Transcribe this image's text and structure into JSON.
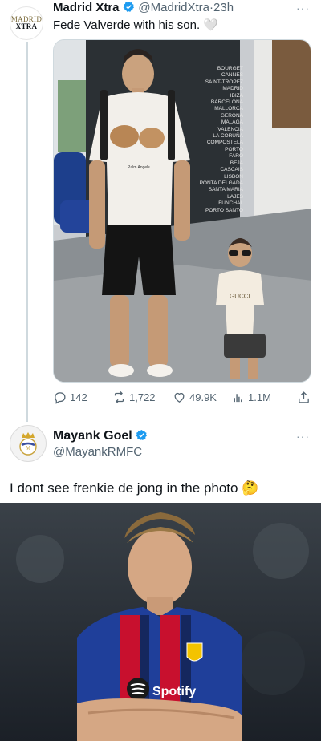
{
  "tweet1": {
    "avatar_text_top": "MADRID",
    "avatar_text_bottom": "XTRA",
    "name": "Madrid Xtra",
    "handle": "@MadridXtra",
    "separator": "·",
    "time": "23h",
    "more": "···",
    "text": "Fede Valverde with his son.",
    "emoji": "🤍",
    "wall_cities": [
      "BOURGET",
      "CANNES",
      "SAINT-TROPEZ",
      "MADRID",
      "IBIZA",
      "BARCELONA",
      "MALLORCA",
      "GERONA",
      "MALAGA",
      "VALENCIA",
      "LA CORUÑA",
      "COMPOSTELA",
      "PORTO",
      "FARO",
      "BEJA",
      "CASCAIS",
      "LISBON",
      "PONTA DELGADA",
      "SANTA MARIA",
      "LAJES",
      "FUNCHAL",
      "PORTO SANTO"
    ],
    "shirt_text": "Palm Angels",
    "kid_shirt_text": "GUCCI",
    "actions": {
      "replies": "142",
      "retweets": "1,722",
      "likes": "49.9K",
      "views": "1.1M"
    }
  },
  "tweet2": {
    "name": "Mayank Goel",
    "handle": "@MayankRMFC",
    "more": "···",
    "text": "I dont see frenkie de jong in the photo",
    "emoji": "🤔",
    "sponsor_text": "Spotify"
  },
  "colors": {
    "verified": "#1d9bf0",
    "secondary_text": "#536471",
    "barca_blue": "#1f3f9a",
    "barca_red": "#c8102e"
  }
}
